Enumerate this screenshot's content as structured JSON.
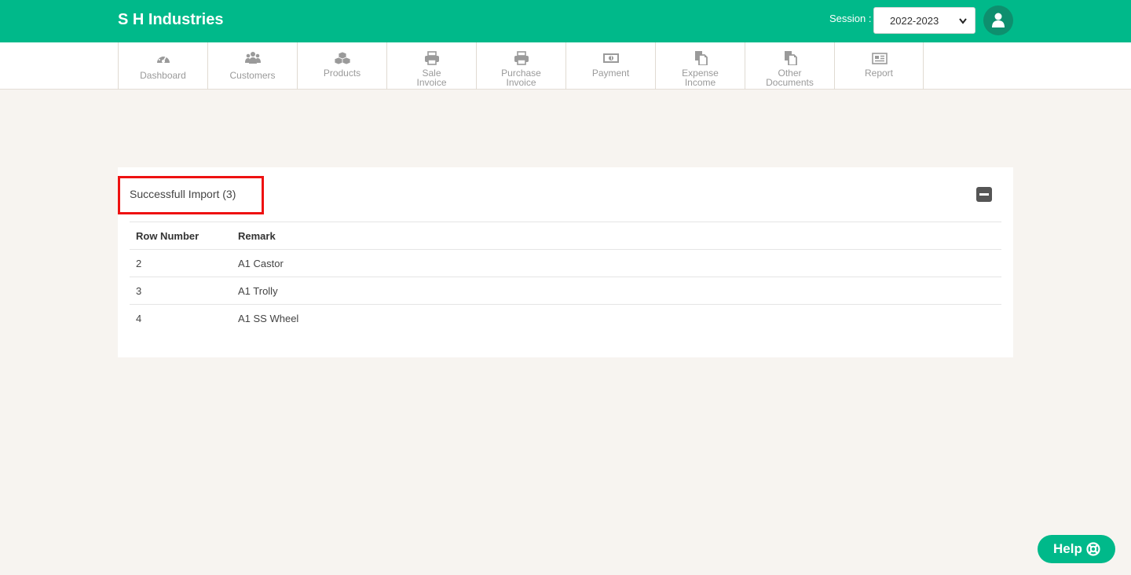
{
  "header": {
    "brand": "S H Industries",
    "session_label": "Session :",
    "session_value": "2022-2023",
    "accent_color": "#00b98a"
  },
  "nav": {
    "items": [
      {
        "label_1": "Dashboard",
        "label_2": "",
        "icon": "dashboard-gauge-icon"
      },
      {
        "label_1": "Customers",
        "label_2": "",
        "icon": "users-group-icon"
      },
      {
        "label_1": "Products",
        "label_2": "",
        "icon": "cubes-icon"
      },
      {
        "label_1": "Sale",
        "label_2": "Invoice",
        "icon": "printer-icon"
      },
      {
        "label_1": "Purchase",
        "label_2": "Invoice",
        "icon": "printer-icon"
      },
      {
        "label_1": "Payment",
        "label_2": "",
        "icon": "money-bill-icon"
      },
      {
        "label_1": "Expense",
        "label_2": "Income",
        "icon": "copy-documents-icon"
      },
      {
        "label_1": "Other",
        "label_2": "Documents",
        "icon": "copy-documents-icon"
      },
      {
        "label_1": "Report",
        "label_2": "",
        "icon": "newspaper-icon"
      }
    ]
  },
  "panel": {
    "title": "Successfull Import (3)",
    "columns": [
      "Row Number",
      "Remark"
    ],
    "rows": [
      {
        "row_number": "2",
        "remark": "A1 Castor"
      },
      {
        "row_number": "3",
        "remark": "A1 Trolly"
      },
      {
        "row_number": "4",
        "remark": "A1 SS Wheel"
      }
    ]
  },
  "help": {
    "label": "Help",
    "icon": "life-ring-icon"
  }
}
